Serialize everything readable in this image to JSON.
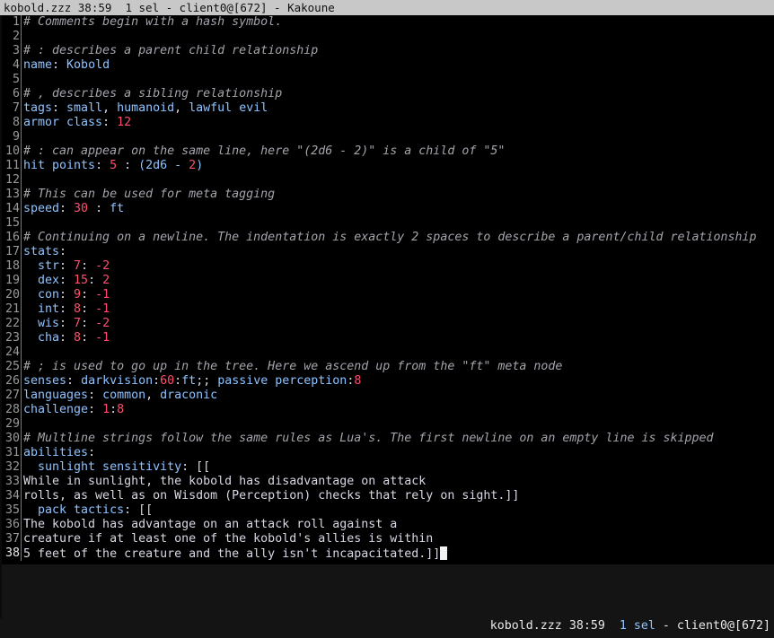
{
  "window": {
    "title": "kobold.zzz 38:59  1 sel - client0@[672] - Kakoune"
  },
  "editor": {
    "lines": [
      [
        {
          "c": "c",
          "t": "# Comments begin with a hash symbol."
        }
      ],
      [],
      [
        {
          "c": "c",
          "t": "# : describes a parent child relationship"
        }
      ],
      [
        {
          "c": "k",
          "t": "name"
        },
        {
          "c": "t",
          "t": ": "
        },
        {
          "c": "k",
          "t": "Kobold"
        }
      ],
      [],
      [
        {
          "c": "c",
          "t": "# , describes a sibling relationship"
        }
      ],
      [
        {
          "c": "k",
          "t": "tags"
        },
        {
          "c": "t",
          "t": ": "
        },
        {
          "c": "k",
          "t": "small"
        },
        {
          "c": "t",
          "t": ", "
        },
        {
          "c": "k",
          "t": "humanoid"
        },
        {
          "c": "t",
          "t": ", "
        },
        {
          "c": "k",
          "t": "lawful evil"
        }
      ],
      [
        {
          "c": "k",
          "t": "armor class"
        },
        {
          "c": "t",
          "t": ": "
        },
        {
          "c": "n",
          "t": "12"
        }
      ],
      [],
      [
        {
          "c": "c",
          "t": "# : can appear on the same line, here \"(2d6 - 2)\" is a child of \"5\""
        }
      ],
      [
        {
          "c": "k",
          "t": "hit points"
        },
        {
          "c": "t",
          "t": ": "
        },
        {
          "c": "n",
          "t": "5"
        },
        {
          "c": "t",
          "t": " : "
        },
        {
          "c": "k",
          "t": "(2d6 - "
        },
        {
          "c": "n",
          "t": "2"
        },
        {
          "c": "k",
          "t": ")"
        }
      ],
      [],
      [
        {
          "c": "c",
          "t": "# This can be used for meta tagging"
        }
      ],
      [
        {
          "c": "k",
          "t": "speed"
        },
        {
          "c": "t",
          "t": ": "
        },
        {
          "c": "n",
          "t": "30"
        },
        {
          "c": "t",
          "t": " : "
        },
        {
          "c": "k",
          "t": "ft"
        }
      ],
      [],
      [
        {
          "c": "c",
          "t": "# Continuing on a newline. The indentation is exactly 2 spaces to describe a parent/child relationship"
        }
      ],
      [
        {
          "c": "k",
          "t": "stats"
        },
        {
          "c": "t",
          "t": ":"
        }
      ],
      [
        {
          "c": "k",
          "t": "  str"
        },
        {
          "c": "t",
          "t": ": "
        },
        {
          "c": "n",
          "t": "7"
        },
        {
          "c": "t",
          "t": ": "
        },
        {
          "c": "n",
          "t": "-2"
        }
      ],
      [
        {
          "c": "k",
          "t": "  dex"
        },
        {
          "c": "t",
          "t": ": "
        },
        {
          "c": "n",
          "t": "15"
        },
        {
          "c": "t",
          "t": ": "
        },
        {
          "c": "n",
          "t": "2"
        }
      ],
      [
        {
          "c": "k",
          "t": "  con"
        },
        {
          "c": "t",
          "t": ": "
        },
        {
          "c": "n",
          "t": "9"
        },
        {
          "c": "t",
          "t": ": "
        },
        {
          "c": "n",
          "t": "-1"
        }
      ],
      [
        {
          "c": "k",
          "t": "  int"
        },
        {
          "c": "t",
          "t": ": "
        },
        {
          "c": "n",
          "t": "8"
        },
        {
          "c": "t",
          "t": ": "
        },
        {
          "c": "n",
          "t": "-1"
        }
      ],
      [
        {
          "c": "k",
          "t": "  wis"
        },
        {
          "c": "t",
          "t": ": "
        },
        {
          "c": "n",
          "t": "7"
        },
        {
          "c": "t",
          "t": ": "
        },
        {
          "c": "n",
          "t": "-2"
        }
      ],
      [
        {
          "c": "k",
          "t": "  cha"
        },
        {
          "c": "t",
          "t": ": "
        },
        {
          "c": "n",
          "t": "8"
        },
        {
          "c": "t",
          "t": ": "
        },
        {
          "c": "n",
          "t": "-1"
        }
      ],
      [],
      [
        {
          "c": "c",
          "t": "# ; is used to go up in the tree. Here we ascend up from the \"ft\" meta node"
        }
      ],
      [
        {
          "c": "k",
          "t": "senses"
        },
        {
          "c": "t",
          "t": ": "
        },
        {
          "c": "k",
          "t": "darkvision"
        },
        {
          "c": "t",
          "t": ":"
        },
        {
          "c": "n",
          "t": "60"
        },
        {
          "c": "t",
          "t": ":"
        },
        {
          "c": "k",
          "t": "ft"
        },
        {
          "c": "t",
          "t": ";; "
        },
        {
          "c": "k",
          "t": "passive perception"
        },
        {
          "c": "t",
          "t": ":"
        },
        {
          "c": "n",
          "t": "8"
        }
      ],
      [
        {
          "c": "k",
          "t": "languages"
        },
        {
          "c": "t",
          "t": ": "
        },
        {
          "c": "k",
          "t": "common"
        },
        {
          "c": "t",
          "t": ", "
        },
        {
          "c": "k",
          "t": "draconic"
        }
      ],
      [
        {
          "c": "k",
          "t": "challenge"
        },
        {
          "c": "t",
          "t": ": "
        },
        {
          "c": "n",
          "t": "1"
        },
        {
          "c": "t",
          "t": ":"
        },
        {
          "c": "n",
          "t": "8"
        }
      ],
      [],
      [
        {
          "c": "c",
          "t": "# Multline strings follow the same rules as Lua's. The first newline on an empty line is skipped"
        }
      ],
      [
        {
          "c": "k",
          "t": "abilities"
        },
        {
          "c": "t",
          "t": ":"
        }
      ],
      [
        {
          "c": "k",
          "t": "  sunlight sensitivity"
        },
        {
          "c": "t",
          "t": ": [["
        }
      ],
      [
        {
          "c": "t",
          "t": "While in sunlight, the kobold has disadvantage on attack"
        }
      ],
      [
        {
          "c": "t",
          "t": "rolls, as well as on Wisdom (Perception) checks that rely on sight.]]"
        }
      ],
      [
        {
          "c": "k",
          "t": "  pack tactics"
        },
        {
          "c": "t",
          "t": ": [["
        }
      ],
      [
        {
          "c": "t",
          "t": "The kobold has advantage on an attack roll against a"
        }
      ],
      [
        {
          "c": "t",
          "t": "creature if at least one of the kobold's allies is within"
        }
      ],
      [
        {
          "c": "t",
          "t": "5 feet of the creature and the ally isn't incapacitated.]]"
        }
      ]
    ],
    "current_line": 38
  },
  "status": {
    "file": "kobold.zzz",
    "position": "38:59",
    "selections": "1 sel",
    "client": "- client0@[672]"
  }
}
